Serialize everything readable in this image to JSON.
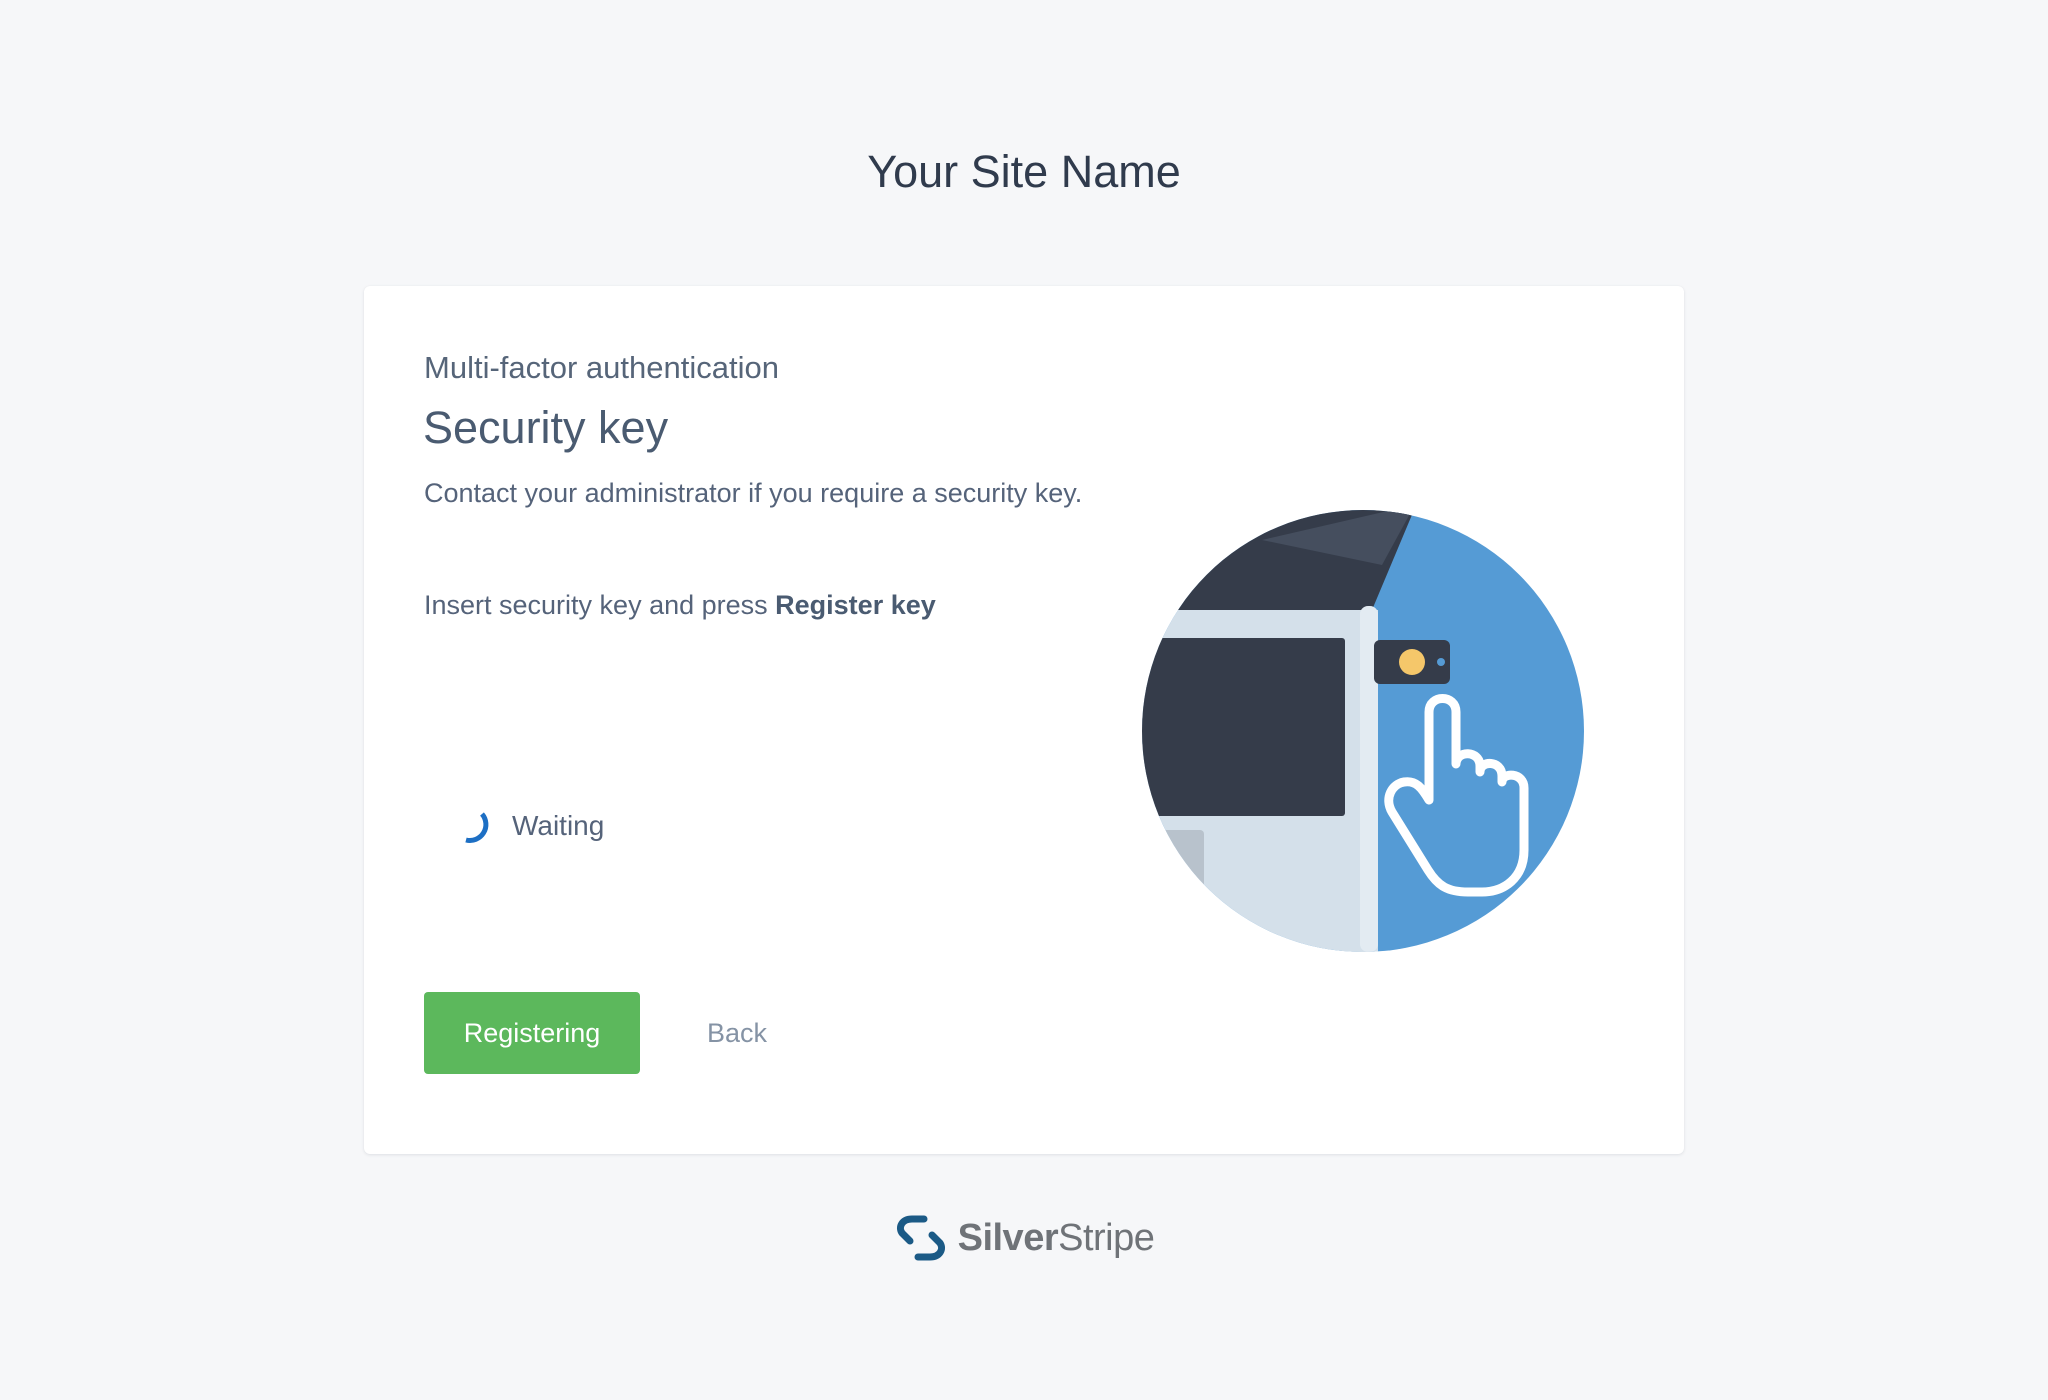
{
  "site": {
    "title": "Your Site Name"
  },
  "card": {
    "eyebrow": "Multi-factor authentication",
    "title": "Security key",
    "description": "Contact your administrator if you require a security key.",
    "instruction_prefix": "Insert security key and press ",
    "instruction_bold": "Register key",
    "status": {
      "icon": "spinner-icon",
      "text": "Waiting"
    },
    "buttons": {
      "primary_label": "Registering",
      "back_label": "Back"
    },
    "illustration": {
      "icon": "security-key-touch-illustration"
    }
  },
  "footer": {
    "brand_part1": "Silver",
    "brand_part2": "Stripe",
    "logo_icon": "silverstripe-logo-icon"
  },
  "colors": {
    "background": "#f6f7f9",
    "primary_button": "#5cb85c",
    "accent_blue": "#559bd5",
    "spinner": "#1d6fc4",
    "text": "#55637a"
  }
}
